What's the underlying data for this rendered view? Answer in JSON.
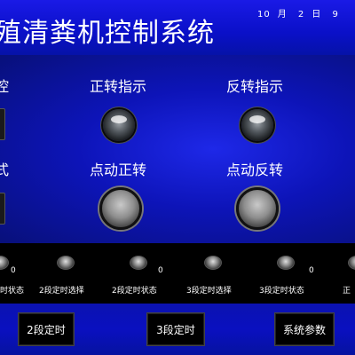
{
  "header": {
    "title": "殖清粪机控制系统",
    "date": {
      "month": "10",
      "month_unit": "月",
      "day": "2",
      "day_unit": "日",
      "extra": "9"
    }
  },
  "panel": {
    "partial_left_top": "控",
    "partial_left_mid": "式",
    "forward_indicator_label": "正转指示",
    "reverse_indicator_label": "反转指示",
    "jog_forward_label": "点动正转",
    "jog_reverse_label": "点动反转"
  },
  "strip": {
    "items": [
      {
        "label": "时状态",
        "value": "0"
      },
      {
        "label": "2段定时选择",
        "value": ""
      },
      {
        "label": "2段定时状态",
        "value": "0"
      },
      {
        "label": "3段定时选择",
        "value": ""
      },
      {
        "label": "3段定时状态",
        "value": "0"
      },
      {
        "label": "正",
        "value": ""
      }
    ]
  },
  "bottom": {
    "btn_2": "2段定时",
    "btn_3": "3段定时",
    "btn_params": "系统参数"
  },
  "colors": {
    "accent": "#0d14b8",
    "background": "#000000",
    "text": "#ffffff"
  }
}
